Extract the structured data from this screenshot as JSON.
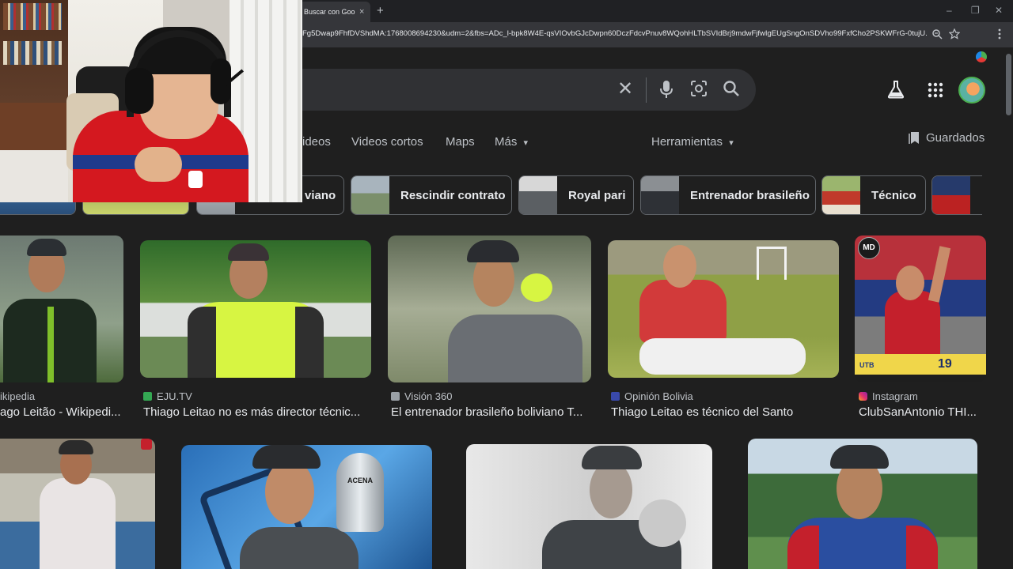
{
  "browser": {
    "tab_title": "Buscar con Goo",
    "tab_close": "×",
    "new_tab": "+",
    "url": "Fg5Dwap9FhfDVShdMA:1768008694230&udm=2&fbs=ADc_l-bpk8W4E-qsVIOvbGJcDwpn60DczFdcvPnuv8WQohHLTbSVIdBrj9mdwFjfwIgEUgSngOnSDVho99FxfCho2PSKWFrG-0tujU...",
    "window_controls": [
      "–",
      "❐",
      "✕"
    ]
  },
  "search": {
    "clear_glyph": "✕",
    "icons": [
      "close-icon",
      "mic-icon",
      "lens-icon",
      "search-icon",
      "labs-icon",
      "apps-grid-icon"
    ]
  },
  "nav": {
    "tabs": [
      "ideos",
      "Videos cortos",
      "Maps",
      "Más"
    ],
    "more_caret": "▾",
    "tools": "Herramientas",
    "tools_caret": "▾",
    "saved": "Guardados"
  },
  "chips": [
    {
      "label": "viano"
    },
    {
      "label": "Rescindir contrato"
    },
    {
      "label": "Royal pari"
    },
    {
      "label": "Entrenador brasileño"
    },
    {
      "label": "Técnico"
    }
  ],
  "results_row1": [
    {
      "source": "ikipedia",
      "title": "ago Leitão - Wikipedi...",
      "fav_color": "#9aa0a6"
    },
    {
      "source": "EJU.TV",
      "title": "Thiago Leitao no es más director técnic...",
      "fav_color": "#34a853"
    },
    {
      "source": "Visión 360",
      "title": "El entrenador brasileño boliviano T...",
      "fav_color": "#9aa0a6"
    },
    {
      "source": "Opinión Bolivia",
      "title": "Thiago Leitao es técnico del Santo",
      "fav_color": "#3949ab"
    },
    {
      "source": "Instagram",
      "title": "ClubSanAntonio THI...",
      "fav_color": "#e1306c"
    }
  ],
  "image_overlays": {
    "md_badge": "MD",
    "utb_text": "UTB",
    "banner_num": "19",
    "trophy_text": "ACENA"
  },
  "colors": {
    "background": "#1f1f1f",
    "searchbox": "#303134",
    "chip_border": "#5f6368",
    "text_primary": "#e8eaed",
    "text_secondary": "#bdc1c6"
  }
}
